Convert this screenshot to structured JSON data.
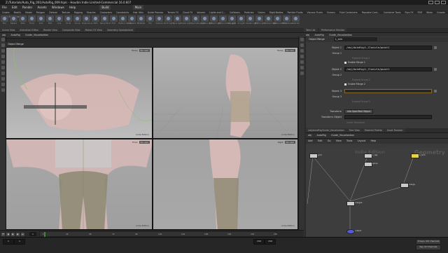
{
  "window": {
    "title": "Z:/Tutorials/Auto_Rig_001/AutoRig_009.hiplc - Houdini Indie Limited-Commercial 16.0.607"
  },
  "menu": [
    "File",
    "Edit",
    "Render",
    "Assets",
    "Windows",
    "Help",
    "Build",
    "Main"
  ],
  "shelf": {
    "tabs": [
      "Create",
      "Modify",
      "Model",
      "Polygon",
      "Deform",
      "Texture",
      "Rigging",
      "Muscles",
      "Characters",
      "Constraints",
      "Hair Utils",
      "Guide Process",
      "Terrain FX",
      "Cloud FX",
      "Volume",
      "Lights and C...",
      "Collisions",
      "Particles",
      "Grains",
      "Rigid Bodies",
      "Particle Fluids",
      "Viscous Fluids",
      "Oceans",
      "Fluid Containers",
      "Populate Cont...",
      "Container Tools",
      "Pyro FX",
      "FEM",
      "Wires",
      "Crowds",
      "Drive Simulation"
    ],
    "tools": [
      "Box",
      "Sphere",
      "Tube",
      "Torus",
      "Grid",
      "Null",
      "Line",
      "Circle",
      "Curve",
      "Draw Curve",
      "Path",
      "Spray Paint",
      "Font",
      "Platonic Solids",
      "L-System",
      "Metaball",
      "File",
      "Camera",
      "Point Light",
      "Spot Light",
      "Area Light",
      "Geometry Light",
      "Volume Light",
      "Distant Light",
      "Environment Light",
      "Sky Light",
      "GI Light",
      "Caustic Light",
      "Portal Light",
      "Ambient Light",
      "Stereo Camera",
      "VR Camera",
      "Switcher"
    ]
  },
  "left_pane": {
    "tabs": [
      "Scene View",
      "Animation Editor",
      "Render View",
      "Composite View",
      "Motion FX View",
      "Geometry Spreadsheet"
    ],
    "path": [
      "obj",
      "AutoRig",
      "Guide_Visualization"
    ],
    "operator": "Object Merge"
  },
  "viewports": [
    {
      "name": "Persp",
      "cam": "No cam",
      "corner": "Indie Edition"
    },
    {
      "name": "Persp",
      "cam": "No cam",
      "corner": "Indie Edition"
    },
    {
      "name": "Front",
      "cam": "No cam",
      "corner": "Indie Edition"
    },
    {
      "name": "Right",
      "cam": "No cam",
      "corner": "Indie Edition"
    }
  ],
  "params": {
    "tabs": [
      "Take List",
      "Performance Monitor"
    ],
    "path": [
      "obj",
      "AutoRig",
      "Guide_Visualization"
    ],
    "header_type": "Object Merge",
    "header_name": "L_arm",
    "object1_label": "Object 1",
    "object1_value": "/obj/AutoRig/L_Clavicle/point1",
    "group1_label": "Group 1",
    "expand_group1": "Expand Group 1",
    "enable_merge1": "Enable Merge 1",
    "object2_label": "Object 2",
    "object2_value": "/obj/AutoRig/L_Clavicle/point1",
    "group2_label": "Group 2",
    "expand_group2": "Expand Group 2",
    "enable_merge2": "Enable Merge 2",
    "object3_label": "Object 3",
    "group3_label": "Group 3",
    "expand_group3": "Expand Group 3",
    "transform_label": "Transform",
    "transform_value": "Into Specified Object",
    "transform_object_label": "Transform Object",
    "invert_transform": "Invert Transform"
  },
  "network": {
    "tabs": [
      "/obj/AutoRig/Guide_Visualization",
      "Tree View",
      "Material Palette",
      "Asset Browser"
    ],
    "path": [
      "obj",
      "AutoRig",
      "Guide_Visualization"
    ],
    "menu": [
      "Add",
      "Edit",
      "Go",
      "View",
      "Tools",
      "Layout",
      "Help"
    ],
    "watermark": "Geometry",
    "watermark_sub": "Indie Edition",
    "nodes": [
      {
        "label": "L_arm",
        "sel": true
      },
      {
        "label": "grid",
        "sel": false
      },
      {
        "label": "L_leg",
        "sel": false
      },
      {
        "label": "spine",
        "sel": false
      },
      {
        "label": "merge",
        "sel": false
      },
      {
        "label": "merge1",
        "sel": false
      },
      {
        "label": "output",
        "sel": false
      }
    ]
  },
  "timeline": {
    "frame": "1",
    "ticks": [
      "1",
      "24",
      "48",
      "72",
      "96",
      "120",
      "144",
      "168",
      "192",
      "216",
      "240"
    ],
    "start": "1",
    "end": "240",
    "range_start": "1",
    "range_end": "240",
    "keys_label": "0 keys, 0/0 channels",
    "key_all": "Key All Channels"
  }
}
